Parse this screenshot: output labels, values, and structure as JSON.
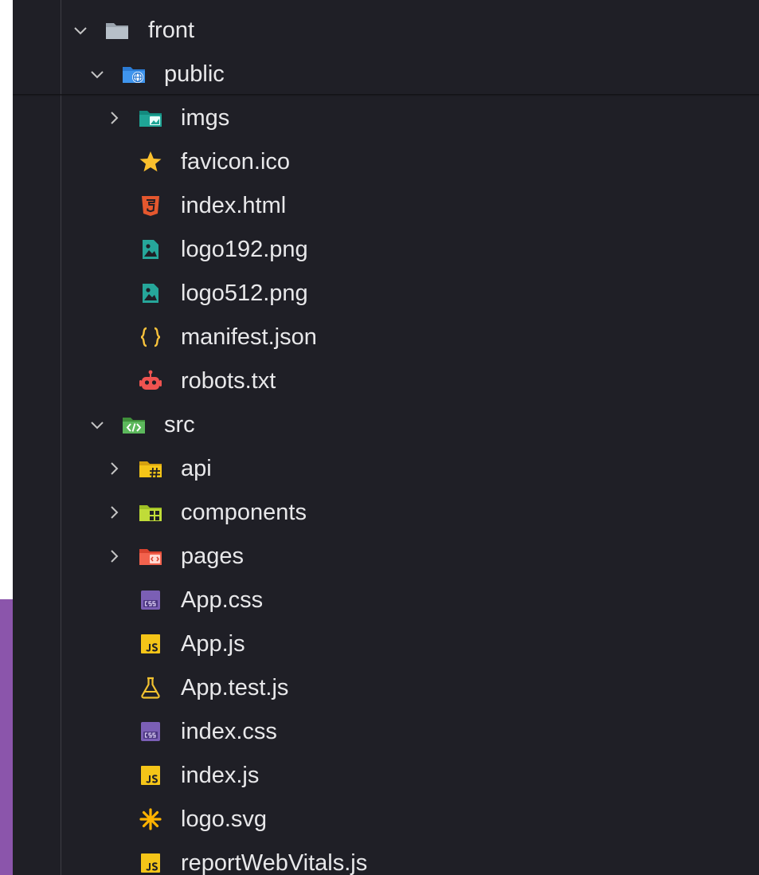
{
  "tree": {
    "items": [
      {
        "label": "front",
        "kind": "folder",
        "expanded": true,
        "icon": "folder-icon"
      },
      {
        "label": "public",
        "kind": "folder",
        "expanded": true,
        "icon": "public-folder-icon"
      },
      {
        "label": "imgs",
        "kind": "folder",
        "expanded": false,
        "icon": "images-folder-icon"
      },
      {
        "label": "favicon.ico",
        "kind": "file",
        "icon": "star-icon"
      },
      {
        "label": "index.html",
        "kind": "file",
        "icon": "html5-icon"
      },
      {
        "label": "logo192.png",
        "kind": "file",
        "icon": "image-file-icon"
      },
      {
        "label": "logo512.png",
        "kind": "file",
        "icon": "image-file-icon"
      },
      {
        "label": "manifest.json",
        "kind": "file",
        "icon": "json-braces-icon"
      },
      {
        "label": "robots.txt",
        "kind": "file",
        "icon": "robot-icon"
      },
      {
        "label": "src",
        "kind": "folder",
        "expanded": true,
        "icon": "source-folder-icon"
      },
      {
        "label": "api",
        "kind": "folder",
        "expanded": false,
        "icon": "api-folder-icon"
      },
      {
        "label": "components",
        "kind": "folder",
        "expanded": false,
        "icon": "components-folder-icon"
      },
      {
        "label": "pages",
        "kind": "folder",
        "expanded": false,
        "icon": "pages-folder-icon"
      },
      {
        "label": "App.css",
        "kind": "file",
        "icon": "css-file-icon"
      },
      {
        "label": "App.js",
        "kind": "file",
        "icon": "js-file-icon"
      },
      {
        "label": "App.test.js",
        "kind": "file",
        "icon": "flask-icon"
      },
      {
        "label": "index.css",
        "kind": "file",
        "icon": "css-file-icon"
      },
      {
        "label": "index.js",
        "kind": "file",
        "icon": "js-file-icon"
      },
      {
        "label": "logo.svg",
        "kind": "file",
        "icon": "svg-asterisk-icon"
      },
      {
        "label": "reportWebVitals.js",
        "kind": "file",
        "icon": "js-file-icon"
      }
    ]
  },
  "colors": {
    "panel_background": "#1f1f26",
    "accent_strip": "#8b55ab",
    "text": "#e8e8ea",
    "chevron": "#c5c5c5",
    "js_yellow": "#f5c518",
    "css_purple": "#7b5fb5",
    "html_orange": "#e4572e",
    "image_teal": "#26a69a",
    "json_yellow": "#f9c23c",
    "robot_red": "#ef5350",
    "flask_yellow": "#f2c230",
    "svg_yellow": "#ffb300",
    "star_yellow": "#fbc02d"
  }
}
